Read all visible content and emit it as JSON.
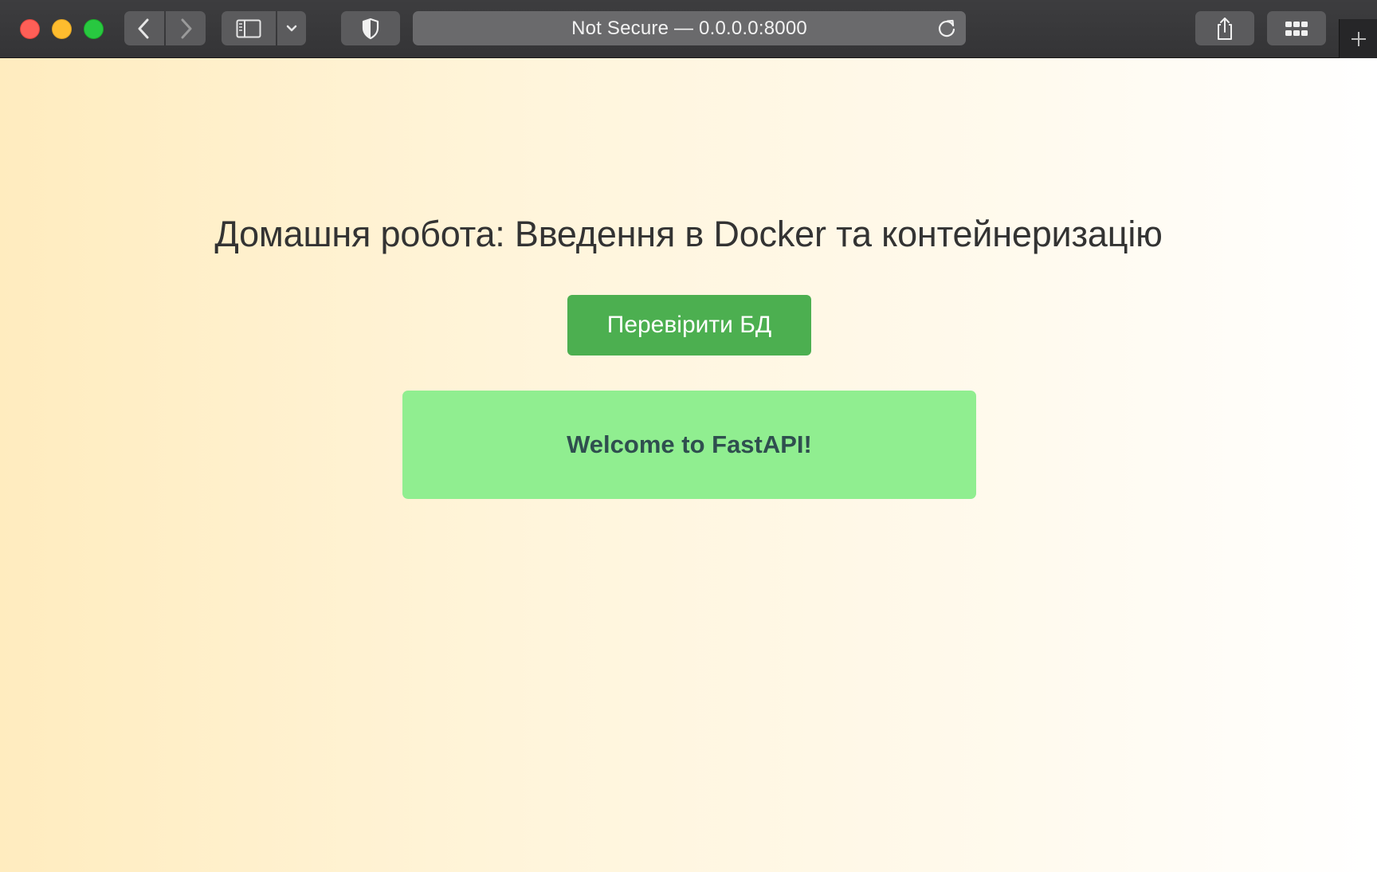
{
  "browser": {
    "address_bar": {
      "text": "Not Secure — 0.0.0.0:8000"
    },
    "icons": {
      "back": "chevron-left-icon",
      "forward": "chevron-right-icon",
      "sidebar": "sidebar-icon",
      "sidebar_dropdown": "chevron-down-icon",
      "privacy": "shield-icon",
      "reload": "reload-icon",
      "share": "share-icon",
      "tabs": "tab-overview-icon",
      "new_tab": "plus-icon"
    }
  },
  "page": {
    "title": "Домашня робота: Введення в Docker та контейнеризацію",
    "check_db_button": "Перевірити БД",
    "result_message": "Welcome to FastAPI!"
  },
  "colors": {
    "button_bg": "#4caf50",
    "result_bg": "#90ee90",
    "result_text": "#2f4f4f",
    "title_text": "#333333",
    "page_gradient_start": "#ffecbf",
    "page_gradient_end": "#ffffff"
  }
}
